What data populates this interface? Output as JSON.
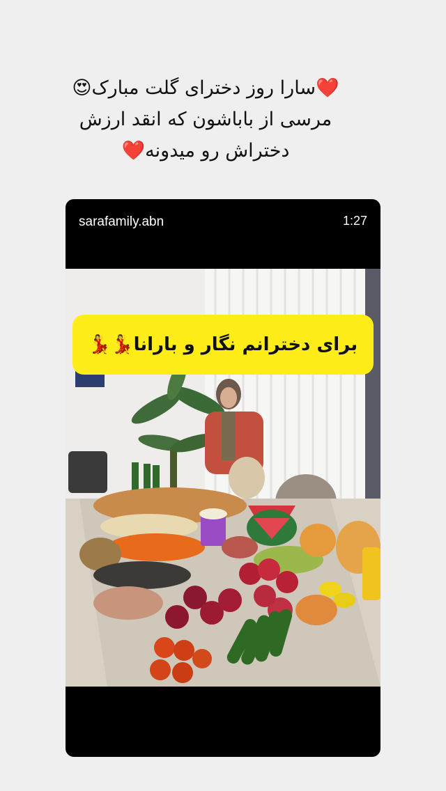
{
  "caption": {
    "line1": "❤️سارا روز دخترای گلت مبارک😍",
    "line2": "مرسی از باباشون که انقد ارزش",
    "line3": "دختراش رو میدونه❤️"
  },
  "video": {
    "username": "sarafamily.abn",
    "duration": "1:27",
    "banner_text": "برای دخترانم نگار و بارانا💃💃"
  }
}
